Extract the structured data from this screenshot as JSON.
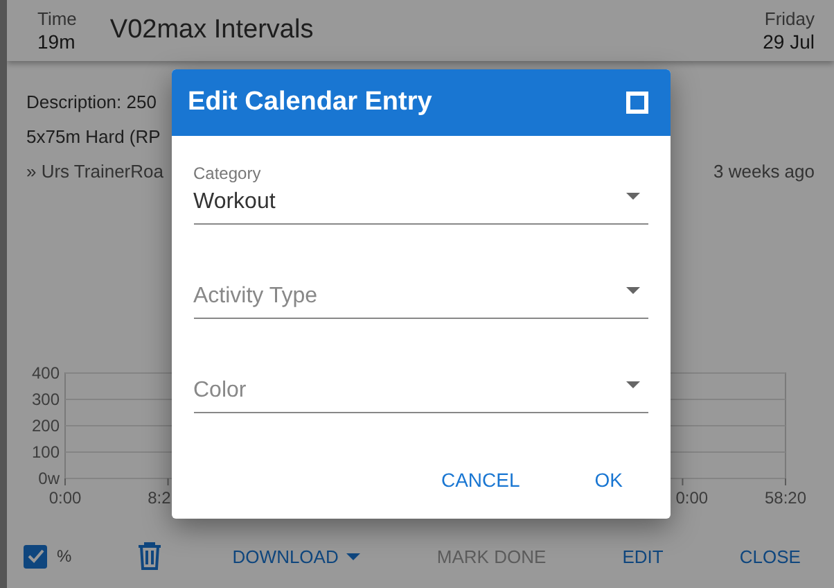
{
  "header": {
    "time_label": "Time",
    "time_value": "19m",
    "title": "V02max Intervals",
    "day_label": "Friday",
    "date": "29 Jul"
  },
  "details": {
    "lines": [
      "Description: 250",
      "5x75m Hard (RP"
    ],
    "source": "» Urs TrainerRoa",
    "age": "3 weeks ago"
  },
  "chart_data": {
    "type": "line",
    "grid": true,
    "ylim": [
      0,
      400
    ],
    "yticks": [
      {
        "value": 0,
        "label": "0w"
      },
      100,
      200,
      300,
      400
    ],
    "xlim": [
      0,
      3500
    ],
    "xticks": [
      {
        "value": 0,
        "label": "0:00"
      },
      {
        "value": 500,
        "label": "8:2"
      },
      {
        "value": 3500,
        "label": "58:20"
      }
    ]
  },
  "chart_cut_label": "0:00",
  "toolbar": {
    "percent": {
      "label": "%",
      "checked": true
    },
    "buttons": [
      {
        "kind": "delete"
      },
      {
        "kind": "menu",
        "label": "DOWNLOAD",
        "disabled": false
      },
      {
        "kind": "text",
        "label": "MARK DONE",
        "disabled": true
      },
      {
        "kind": "text",
        "label": "EDIT",
        "disabled": false
      },
      {
        "kind": "text",
        "label": "CLOSE",
        "disabled": false
      }
    ]
  },
  "dialog": {
    "title": "Edit Calendar Entry",
    "fields": [
      {
        "label": "Category",
        "value": "Workout"
      },
      {
        "placeholder": "Activity Type"
      },
      {
        "placeholder": "Color"
      }
    ],
    "actions": [
      "CANCEL",
      "OK"
    ]
  }
}
